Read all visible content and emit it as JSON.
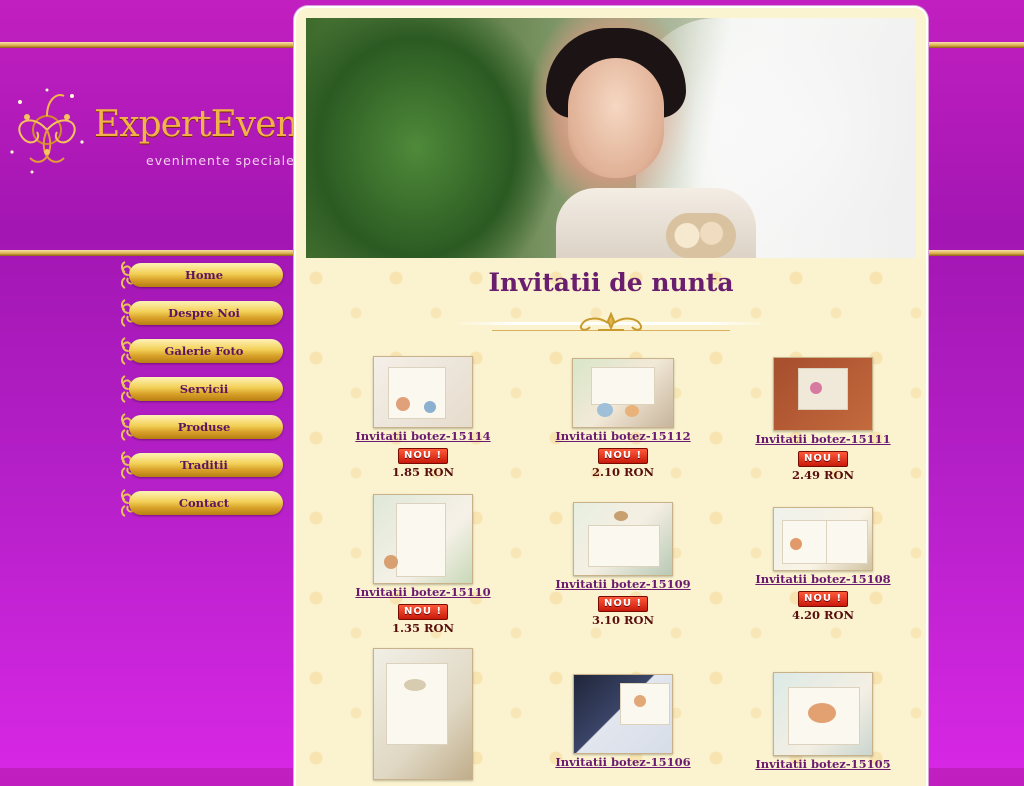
{
  "site": {
    "logo_name": "ExpertEvents",
    "logo_tagline": "evenimente speciale"
  },
  "nav": {
    "items": [
      {
        "label": "Home"
      },
      {
        "label": "Despre Noi"
      },
      {
        "label": "Galerie Foto"
      },
      {
        "label": "Servicii"
      },
      {
        "label": "Produse"
      },
      {
        "label": "Traditii"
      },
      {
        "label": "Contact"
      }
    ]
  },
  "main": {
    "title": "Invitatii de nunta",
    "products": [
      {
        "name": "Invitatii botez-15114",
        "badge": "NOU !",
        "price": "1.85 RON"
      },
      {
        "name": "Invitatii botez-15112",
        "badge": "NOU !",
        "price": "2.10 RON"
      },
      {
        "name": "Invitatii botez-15111",
        "badge": "NOU !",
        "price": "2.49 RON"
      },
      {
        "name": "Invitatii botez-15110",
        "badge": "NOU !",
        "price": "1.35 RON"
      },
      {
        "name": "Invitatii botez-15109",
        "badge": "NOU !",
        "price": "3.10 RON"
      },
      {
        "name": "Invitatii botez-15108",
        "badge": "NOU !",
        "price": "4.20 RON"
      },
      {
        "name": "",
        "badge": "",
        "price": ""
      },
      {
        "name": "Invitatii botez-15106",
        "badge": "",
        "price": ""
      },
      {
        "name": "Invitatii botez-15105",
        "badge": "",
        "price": ""
      }
    ]
  },
  "colors": {
    "background": "#b31fc6",
    "accent_gold": "#f2cf55",
    "link_purple": "#6a1a70",
    "panel_cream": "#fbf4d0"
  }
}
